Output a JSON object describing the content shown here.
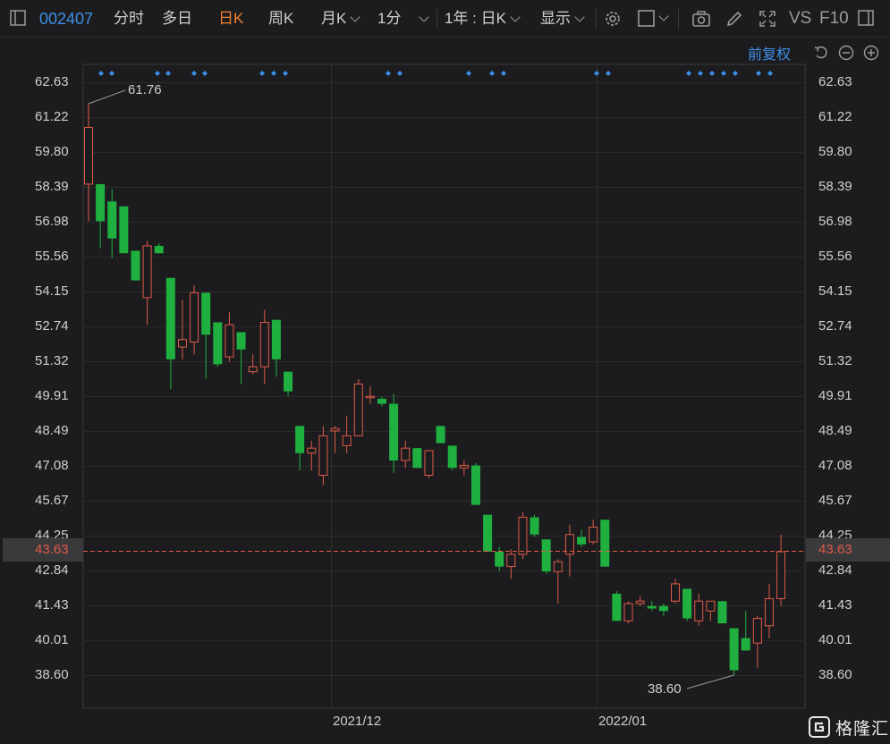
{
  "toolbar": {
    "code": "002407",
    "tabs": [
      "分时",
      "多日",
      "日K",
      "周K"
    ],
    "active_tab": "日K",
    "month_k": "月K",
    "minute": "1分",
    "range": "1年 : 日K",
    "display": "显示",
    "vs": "VS",
    "f10": "F10"
  },
  "adjust_label": "前复权",
  "current_price": "43.63",
  "colors": {
    "up": "#e05a47",
    "down": "#1fb040",
    "accent": "#3d8ee6",
    "active_tab": "#f08030",
    "background": "#1c1c1e"
  },
  "chart_data": {
    "type": "candlestick",
    "y_ticks": [
      "62.63",
      "61.22",
      "59.80",
      "58.39",
      "56.98",
      "55.56",
      "54.15",
      "52.74",
      "51.32",
      "49.91",
      "48.49",
      "47.08",
      "45.67",
      "44.25",
      "42.84",
      "41.43",
      "40.01",
      "38.60"
    ],
    "ylim": [
      37.4,
      64.1
    ],
    "x_labels": [
      "2021/12",
      "2022/01"
    ],
    "current_price_line": 43.63,
    "annotations": [
      "61.76",
      "38.60"
    ],
    "high_label": 61.76,
    "low_label": 38.6,
    "candles": [
      {
        "o": 58.5,
        "h": 61.76,
        "l": 57.0,
        "c": 60.8
      },
      {
        "o": 58.5,
        "h": 58.5,
        "l": 55.9,
        "c": 57.0
      },
      {
        "o": 57.8,
        "h": 58.3,
        "l": 55.5,
        "c": 56.3
      },
      {
        "o": 57.6,
        "h": 57.6,
        "l": 55.7,
        "c": 55.7
      },
      {
        "o": 55.8,
        "h": 55.8,
        "l": 54.6,
        "c": 54.6
      },
      {
        "o": 53.9,
        "h": 56.2,
        "l": 52.8,
        "c": 56.0
      },
      {
        "o": 56.0,
        "h": 56.1,
        "l": 55.7,
        "c": 55.7
      },
      {
        "o": 54.7,
        "h": 54.7,
        "l": 50.2,
        "c": 51.4
      },
      {
        "o": 51.9,
        "h": 53.8,
        "l": 51.4,
        "c": 52.2
      },
      {
        "o": 52.1,
        "h": 54.4,
        "l": 51.6,
        "c": 54.1
      },
      {
        "o": 54.1,
        "h": 54.1,
        "l": 50.6,
        "c": 52.4
      },
      {
        "o": 52.9,
        "h": 52.9,
        "l": 51.1,
        "c": 51.2
      },
      {
        "o": 51.5,
        "h": 53.3,
        "l": 51.3,
        "c": 52.8
      },
      {
        "o": 52.5,
        "h": 52.5,
        "l": 50.4,
        "c": 51.8
      },
      {
        "o": 50.9,
        "h": 51.6,
        "l": 50.8,
        "c": 51.1
      },
      {
        "o": 51.1,
        "h": 53.4,
        "l": 50.4,
        "c": 52.9
      },
      {
        "o": 53.0,
        "h": 53.0,
        "l": 50.7,
        "c": 51.4
      },
      {
        "o": 50.9,
        "h": 50.9,
        "l": 49.9,
        "c": 50.1
      },
      {
        "o": 48.7,
        "h": 48.7,
        "l": 46.9,
        "c": 47.6
      },
      {
        "o": 47.6,
        "h": 48.1,
        "l": 46.9,
        "c": 47.8
      },
      {
        "o": 46.7,
        "h": 48.7,
        "l": 46.3,
        "c": 48.3
      },
      {
        "o": 48.5,
        "h": 48.7,
        "l": 47.6,
        "c": 48.6
      },
      {
        "o": 47.9,
        "h": 49.1,
        "l": 47.6,
        "c": 48.3
      },
      {
        "o": 48.3,
        "h": 50.6,
        "l": 48.3,
        "c": 50.4
      },
      {
        "o": 49.9,
        "h": 50.3,
        "l": 49.6,
        "c": 49.9
      },
      {
        "o": 49.8,
        "h": 49.9,
        "l": 49.5,
        "c": 49.6
      },
      {
        "o": 49.6,
        "h": 50.0,
        "l": 46.8,
        "c": 47.3
      },
      {
        "o": 47.3,
        "h": 48.1,
        "l": 47.0,
        "c": 47.8
      },
      {
        "o": 47.8,
        "h": 47.8,
        "l": 47.0,
        "c": 47.0
      },
      {
        "o": 46.7,
        "h": 47.7,
        "l": 46.6,
        "c": 47.7
      },
      {
        "o": 48.7,
        "h": 48.7,
        "l": 48.0,
        "c": 48.0
      },
      {
        "o": 47.9,
        "h": 47.9,
        "l": 46.9,
        "c": 47.0
      },
      {
        "o": 47.0,
        "h": 47.3,
        "l": 46.7,
        "c": 47.1
      },
      {
        "o": 47.1,
        "h": 47.2,
        "l": 45.5,
        "c": 45.5
      },
      {
        "o": 45.1,
        "h": 45.1,
        "l": 43.6,
        "c": 43.6
      },
      {
        "o": 43.6,
        "h": 43.8,
        "l": 42.8,
        "c": 43.0
      },
      {
        "o": 43.0,
        "h": 43.7,
        "l": 42.5,
        "c": 43.5
      },
      {
        "o": 43.5,
        "h": 45.2,
        "l": 43.3,
        "c": 45.0
      },
      {
        "o": 45.0,
        "h": 45.1,
        "l": 44.2,
        "c": 44.3
      },
      {
        "o": 44.1,
        "h": 44.1,
        "l": 42.7,
        "c": 42.8
      },
      {
        "o": 42.8,
        "h": 43.3,
        "l": 41.5,
        "c": 43.2
      },
      {
        "o": 43.5,
        "h": 44.7,
        "l": 42.6,
        "c": 44.3
      },
      {
        "o": 44.2,
        "h": 44.5,
        "l": 43.8,
        "c": 43.9
      },
      {
        "o": 44.0,
        "h": 44.9,
        "l": 43.9,
        "c": 44.6
      },
      {
        "o": 44.9,
        "h": 44.9,
        "l": 43.0,
        "c": 43.0
      },
      {
        "o": 41.9,
        "h": 42.0,
        "l": 40.8,
        "c": 40.8
      },
      {
        "o": 40.8,
        "h": 41.6,
        "l": 40.7,
        "c": 41.5
      },
      {
        "o": 41.5,
        "h": 41.8,
        "l": 41.4,
        "c": 41.6
      },
      {
        "o": 41.4,
        "h": 41.6,
        "l": 41.2,
        "c": 41.3
      },
      {
        "o": 41.4,
        "h": 41.5,
        "l": 41.0,
        "c": 41.2
      },
      {
        "o": 41.6,
        "h": 42.5,
        "l": 41.5,
        "c": 42.3
      },
      {
        "o": 42.1,
        "h": 42.1,
        "l": 40.8,
        "c": 40.9
      },
      {
        "o": 40.8,
        "h": 41.9,
        "l": 40.6,
        "c": 41.6
      },
      {
        "o": 41.2,
        "h": 41.6,
        "l": 40.8,
        "c": 41.6
      },
      {
        "o": 41.6,
        "h": 41.6,
        "l": 40.7,
        "c": 40.7
      },
      {
        "o": 40.5,
        "h": 40.5,
        "l": 38.6,
        "c": 38.8
      },
      {
        "o": 40.1,
        "h": 41.2,
        "l": 39.6,
        "c": 39.6
      },
      {
        "o": 39.9,
        "h": 41.0,
        "l": 38.9,
        "c": 40.9
      },
      {
        "o": 40.6,
        "h": 42.3,
        "l": 40.1,
        "c": 41.7
      },
      {
        "o": 41.7,
        "h": 44.3,
        "l": 41.4,
        "c": 43.6
      }
    ]
  }
}
